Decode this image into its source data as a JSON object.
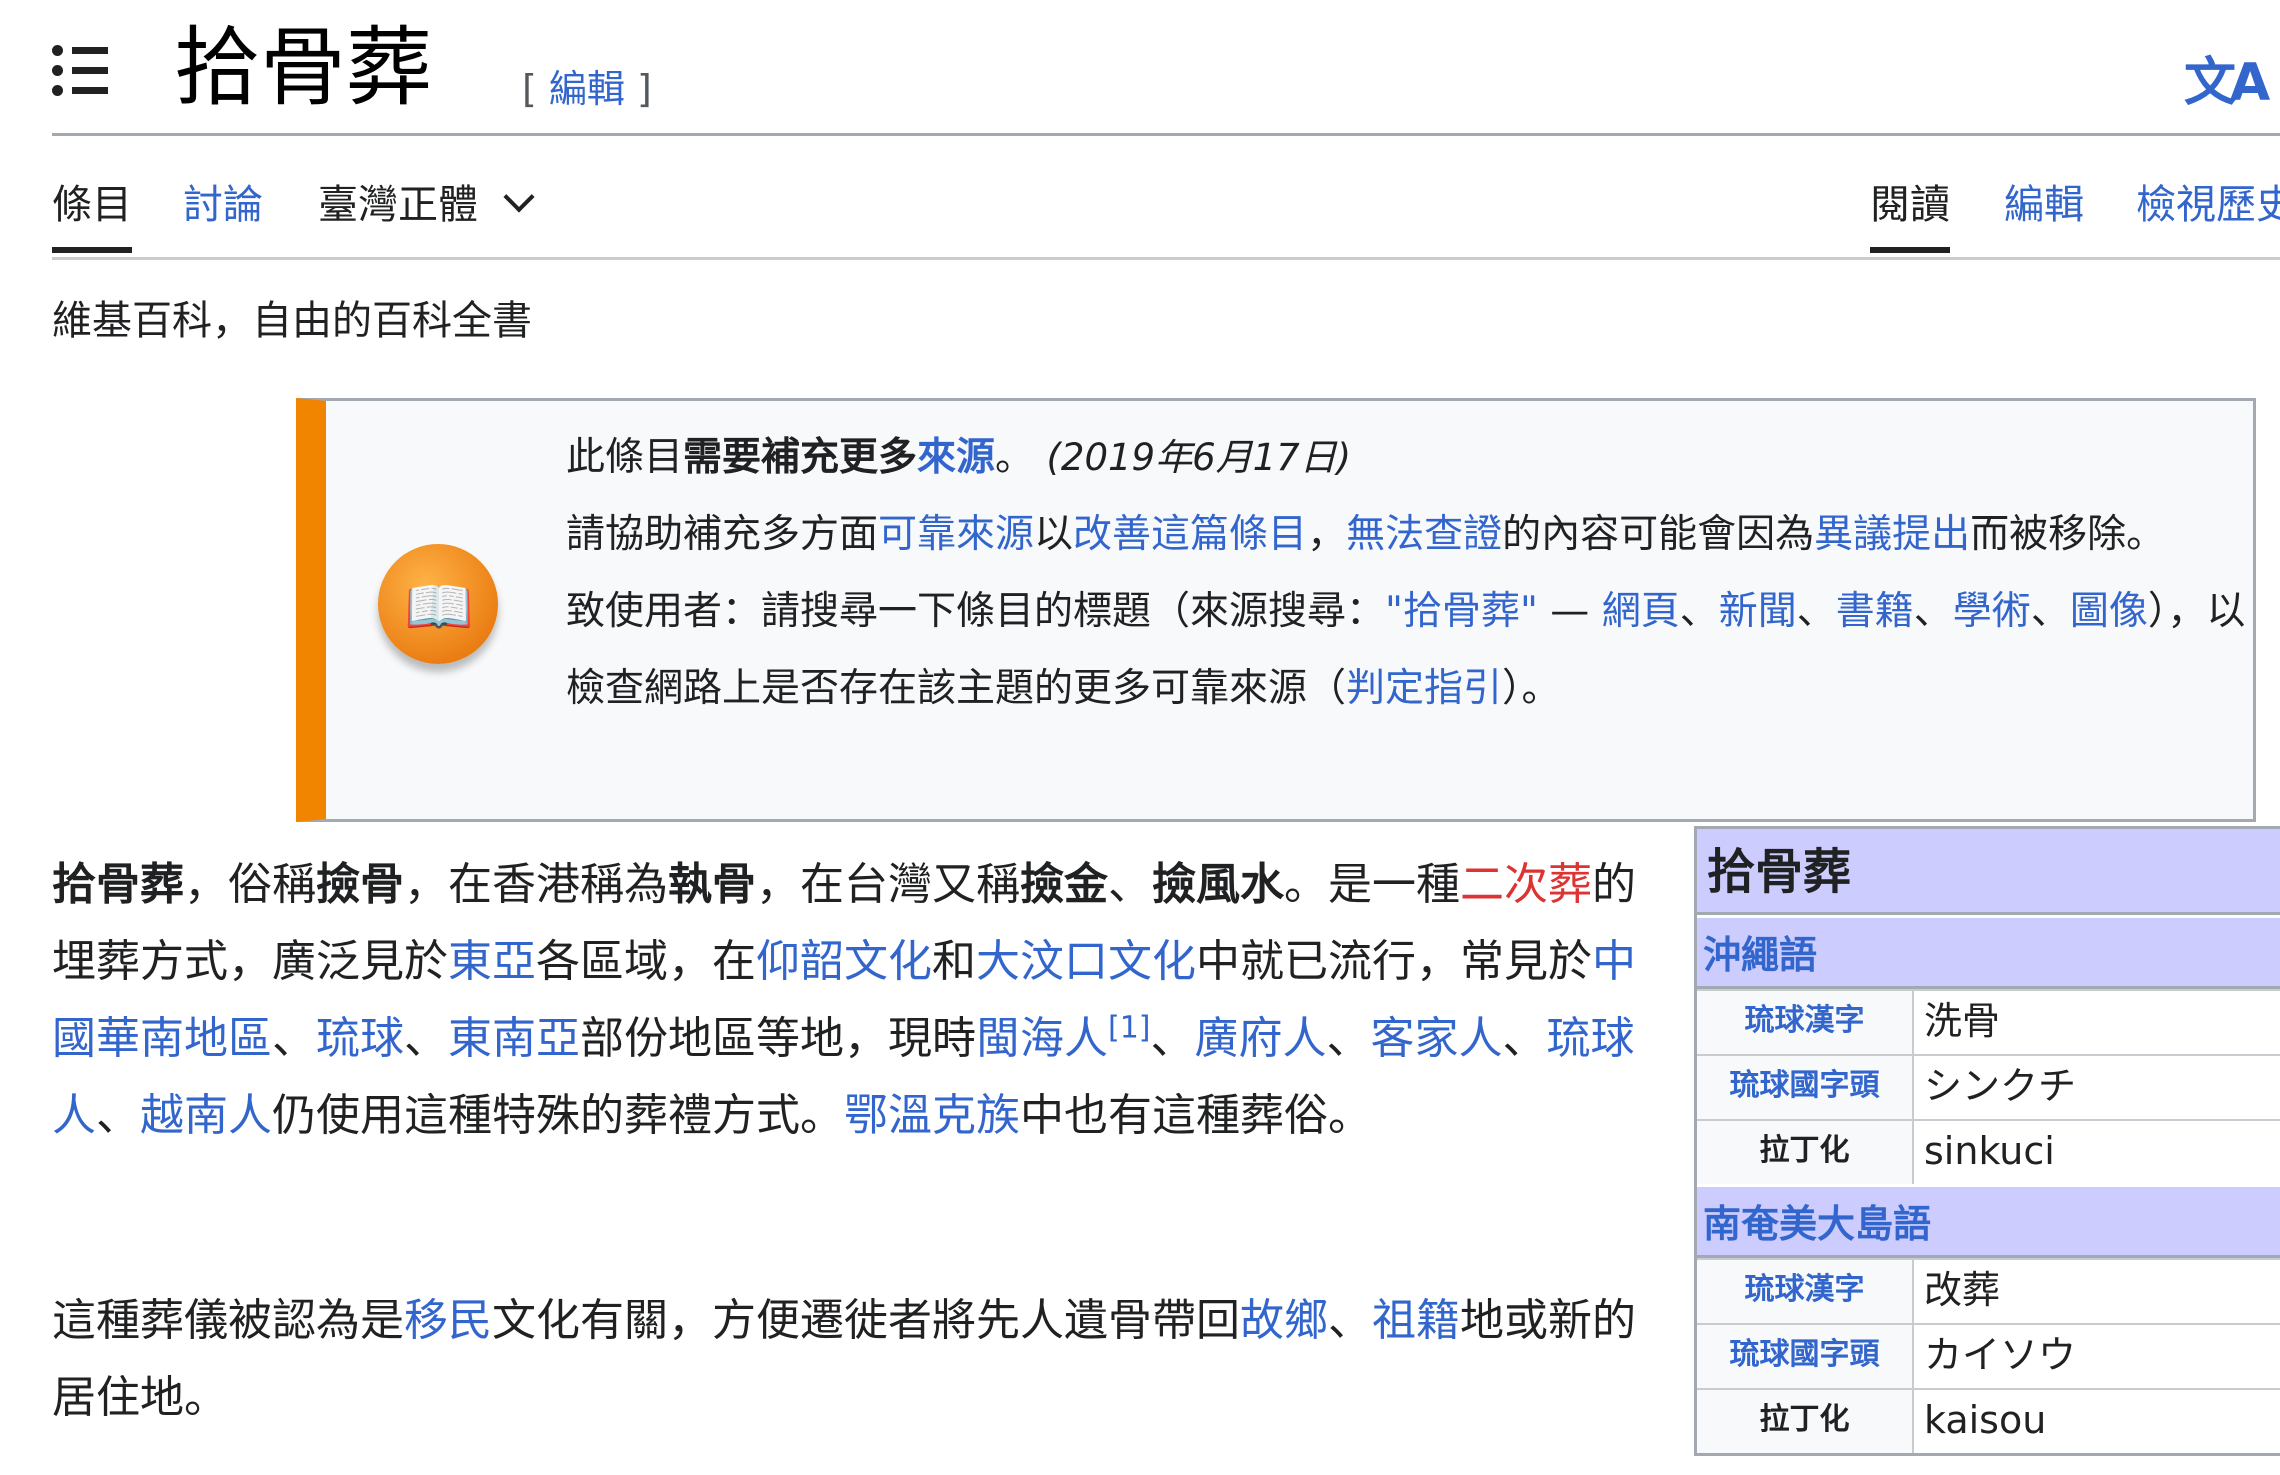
{
  "header": {
    "title": "拾骨葬",
    "edit_open": "[ ",
    "edit_label": "編輯",
    "edit_close": " ]",
    "lang_icon": "文A"
  },
  "tabs": {
    "article": "條目",
    "talk": "討論",
    "variant": "臺灣正體",
    "read": "閱讀",
    "edit": "編輯",
    "history": "檢視歷史"
  },
  "tagline": "維基百科，自由的百科全書",
  "ambox": {
    "l1a": "此條目",
    "l1b": "需要補充更多",
    "l1c": "來源",
    "l1d": "。",
    "l1date": "(2019年6月17日)",
    "l2a": "請協助補充多方面",
    "l2b": "可靠來源",
    "l2c": "以",
    "l2d": "改善這篇條目",
    "l2e": "，",
    "l2f": "無法查證",
    "l2g": "的內容可能會因為",
    "l2h": "異議提出",
    "l2i": "而被移除。",
    "l3a": "致使用者：請搜尋一下條目的標題（來源搜尋：",
    "l3b": "\"拾骨葬\"",
    "l3c": " — ",
    "l3d": "網頁",
    "l3e": "新聞",
    "l3f": "書籍",
    "l3g": "學術",
    "l3h": "圖像",
    "sep": "、",
    "l3i": "），以檢查網路上是否存在該主題的更多可靠來源（",
    "l3j": "判定指引",
    "l3k": "）。"
  },
  "p1": {
    "t1": "拾骨葬",
    "t2": "，俗稱",
    "t3": "撿骨",
    "t4": "，在香港稱為",
    "t5": "執骨",
    "t6": "，在台灣又稱",
    "t7": "撿金",
    "t8": "、",
    "t9": "撿風水",
    "t10": "。是一種",
    "t11": "二次葬",
    "t12": "的埋葬方式，廣泛見於",
    "t13": "東亞",
    "t14": "各區域，在",
    "t15": "仰韶文化",
    "t16": "和",
    "t17": "大汶口文化",
    "t18": "中就已流行，常見於",
    "t19": "中國華南地區",
    "t20": "、",
    "t21": "琉球",
    "t22": "、",
    "t23": "東南亞",
    "t24": "部份地區等地，現時",
    "t25": "閩海人",
    "t26": "[1]",
    "t27": "、",
    "t28": "廣府人",
    "t29": "、",
    "t30": "客家人",
    "t31": "、",
    "t32": "琉球人",
    "t33": "、",
    "t34": "越南人",
    "t35": "仍使用這種特殊的葬禮方式。",
    "t36": "鄂溫克族",
    "t37": "中也有這種葬俗。"
  },
  "p2": {
    "t1": "這種葬儀被認為是",
    "t2": "移民",
    "t3": "文化有關，方便遷徙者將先人遺骨帶回",
    "t4": "故鄉",
    "t5": "、",
    "t6": "祖籍",
    "t7": "地或新的居住地。"
  },
  "infobox": {
    "title": "拾骨葬",
    "sections": [
      {
        "name": "沖繩語",
        "rows": [
          {
            "k": "琉球漢字",
            "v": "洗骨"
          },
          {
            "k": "琉球國字頭",
            "v": "シンクチ"
          },
          {
            "k": "拉丁化",
            "v": "sinkuci"
          }
        ]
      },
      {
        "name": "南奄美大島語",
        "rows": [
          {
            "k": "琉球漢字",
            "v": "改葬"
          },
          {
            "k": "琉球國字頭",
            "v": "カイソウ"
          },
          {
            "k": "拉丁化",
            "v": "kaisou"
          }
        ]
      }
    ]
  }
}
